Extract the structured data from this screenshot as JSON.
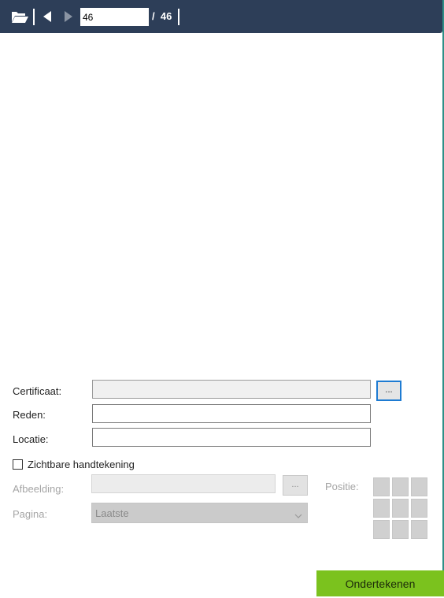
{
  "toolbar": {
    "page_current": "46",
    "page_total": "/  46",
    "icons": [
      "folder-open-icon",
      "previous-page-icon",
      "next-page-icon"
    ]
  },
  "form": {
    "certificate_label": "Certificaat:",
    "certificate_browse_label": "...",
    "reason_label": "Reden:",
    "location_label": "Locatie:",
    "visible_signature_label": "Zichtbare handtekening",
    "visible_signature_checked": false,
    "image_label": "Afbeelding:",
    "image_browse_label": "...",
    "position_label": "Positie:",
    "page_label": "Pagina:",
    "page_selected": "Laatste"
  },
  "sign_button_label": "Ondertekenen",
  "colors": {
    "toolbar": "#2d3e58",
    "accent": "#1e7bd2",
    "sign_button": "#7bc21e"
  }
}
